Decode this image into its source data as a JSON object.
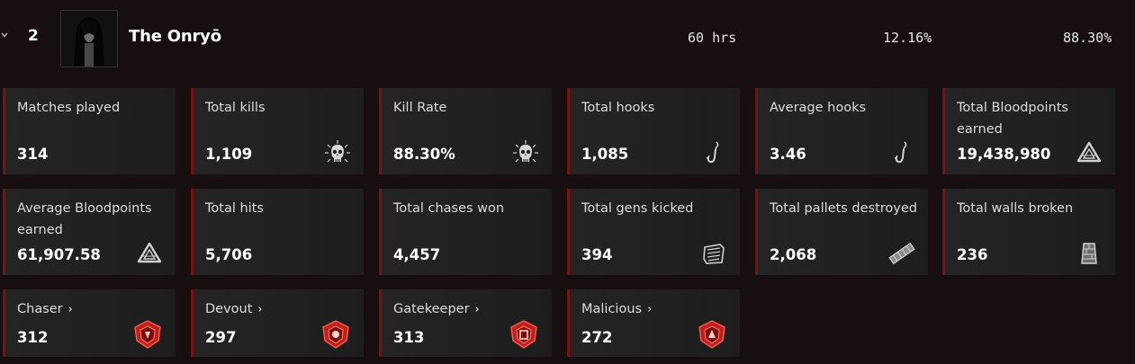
{
  "header": {
    "rank": "2",
    "name": "The Onryō",
    "hours": "60 hrs",
    "pick_rate": "12.16%",
    "kill_rate": "88.30%"
  },
  "stats": [
    {
      "label": "Matches played",
      "value": "314",
      "icon": ""
    },
    {
      "label": "Total kills",
      "value": "1,109",
      "icon": "skull-icon"
    },
    {
      "label": "Kill Rate",
      "value": "88.30%",
      "icon": "skull-icon"
    },
    {
      "label": "Total hooks",
      "value": "1,085",
      "icon": "hook-icon"
    },
    {
      "label": "Average hooks",
      "value": "3.46",
      "icon": "hook-icon"
    },
    {
      "label": "Total Bloodpoints earned",
      "value": "19,438,980",
      "icon": "bloodpoints-icon"
    },
    {
      "label": "Average Bloodpoints earned",
      "value": "61,907.58",
      "icon": "bloodpoints-icon"
    },
    {
      "label": "Total hits",
      "value": "5,706",
      "icon": ""
    },
    {
      "label": "Total chases won",
      "value": "4,457",
      "icon": ""
    },
    {
      "label": "Total gens kicked",
      "value": "394",
      "icon": "generator-icon"
    },
    {
      "label": "Total pallets destroyed",
      "value": "2,068",
      "icon": "pallet-icon"
    },
    {
      "label": "Total walls broken",
      "value": "236",
      "icon": "wall-icon"
    }
  ],
  "achievements": [
    {
      "label": "Chaser",
      "arrow": "›",
      "value": "312",
      "icon": "chaser-emblem-icon"
    },
    {
      "label": "Devout",
      "arrow": "›",
      "value": "297",
      "icon": "devout-emblem-icon"
    },
    {
      "label": "Gatekeeper",
      "arrow": "›",
      "value": "313",
      "icon": "gatekeeper-emblem-icon"
    },
    {
      "label": "Malicious",
      "arrow": "›",
      "value": "272",
      "icon": "malicious-emblem-icon"
    }
  ],
  "colors": {
    "background": "#170f0f",
    "card": "#222222",
    "accent": "#7a1010",
    "emblem": "#c0201c"
  }
}
